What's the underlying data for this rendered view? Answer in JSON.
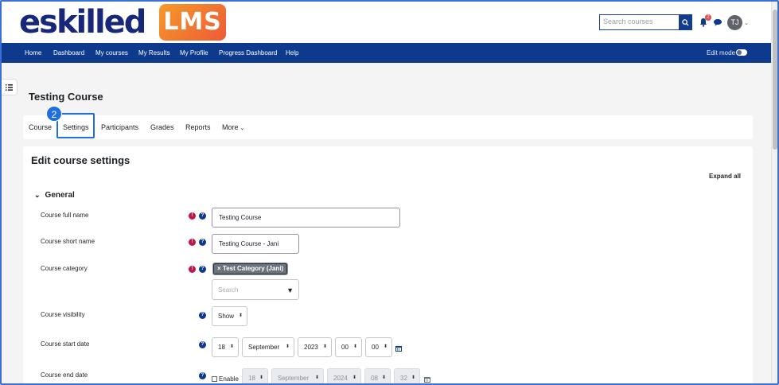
{
  "brand": {
    "logo_text": "eskilled",
    "badge_text": "LMS",
    "primary_color": "#0d3a8c",
    "accent_color": "#1f6fdc"
  },
  "header": {
    "search_placeholder": "Search courses",
    "notification_count": "2",
    "user_initials": "TJ"
  },
  "nav": {
    "items": [
      "Home",
      "Dashboard",
      "My courses",
      "My Results",
      "My Profile",
      "Progress Dashboard",
      "Help"
    ],
    "edit_mode_label": "Edit mode"
  },
  "page": {
    "title": "Testing Course"
  },
  "secondary_nav": {
    "items": [
      "Course",
      "Settings",
      "Participants",
      "Grades",
      "Reports",
      "More"
    ],
    "active": "Settings",
    "step_badge": "2"
  },
  "form": {
    "title": "Edit course settings",
    "expand_all": "Expand all",
    "section": "General",
    "fields": {
      "full_name": {
        "label": "Course full name",
        "value": "Testing Course"
      },
      "short_name": {
        "label": "Course short name",
        "value": "Testing Course - Jani"
      },
      "category": {
        "label": "Course category",
        "chip": "× Test Category (Jani)",
        "search_placeholder": "Search"
      },
      "visibility": {
        "label": "Course visibility",
        "value": "Show"
      },
      "start_date": {
        "label": "Course start date",
        "day": "18",
        "month": "September",
        "year": "2023",
        "hour": "00",
        "minute": "00"
      },
      "end_date": {
        "label": "Course end date",
        "enable_label": "Enable",
        "day": "18",
        "month": "September",
        "year": "2024",
        "hour": "08",
        "minute": "32"
      }
    }
  }
}
